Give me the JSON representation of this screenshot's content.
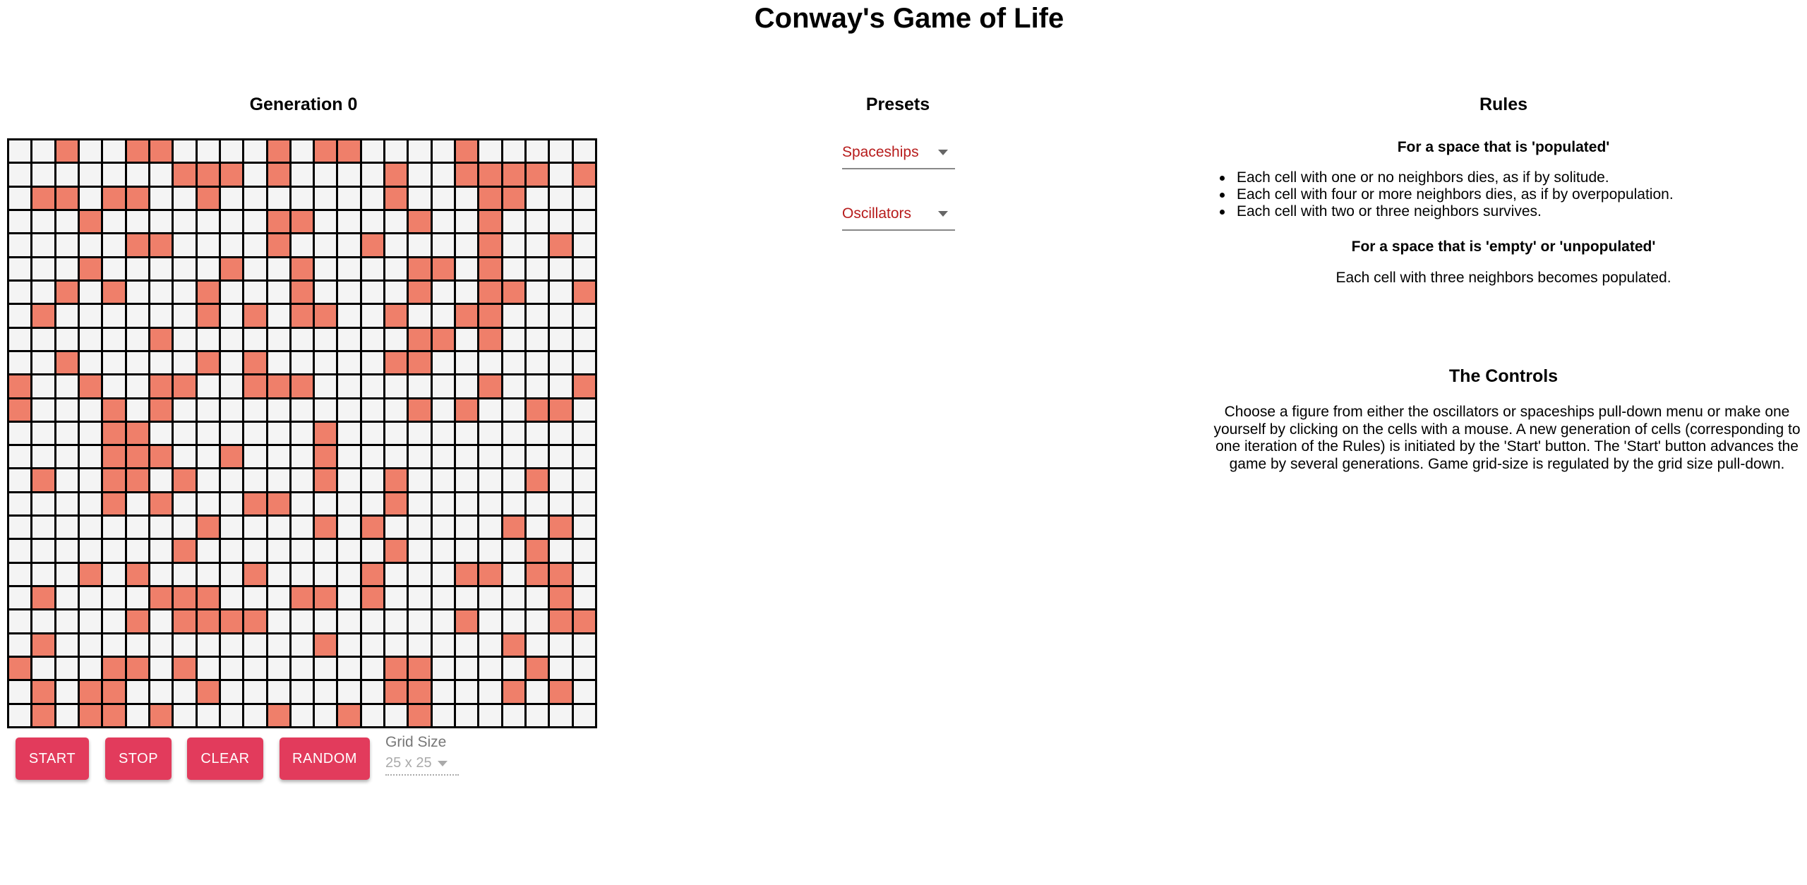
{
  "title": "Conway's Game of Life",
  "generation_heading": "Generation 0",
  "grid": {
    "rows": 25,
    "cols": 25,
    "alive_color": "#ef7f6a",
    "dead_color": "#f4f4f4",
    "alive": [
      "0010011000010110000100000",
      "0000000111010000100111101",
      "0110110010000000100011000",
      "0001000000011000010010000",
      "0000011000010001000010010",
      "0001000001001000011010000",
      "0010100010001000010011001",
      "0100000010101100100110000",
      "0000001000000000011010000",
      "0010000010100000110000000",
      "1001001100111000000010001",
      "1000101000000000010100110",
      "0000110000000100000000000",
      "0000111001000100000000000",
      "0100110100000100100000100",
      "0000101000110000100000000",
      "0000000010000101000001010",
      "0000000100000000100000100",
      "0001010000100001000110110",
      "0100001110001101000000010",
      "0000010111100000000100011",
      "0100000000000100000001000",
      "1000110100000000110000100",
      "0101100010000000110001010",
      "0101101000010010010000000"
    ]
  },
  "controls": {
    "start": "START",
    "stop": "STOP",
    "clear": "CLEAR",
    "random": "RANDOM",
    "grid_size_label": "Grid Size",
    "grid_size_value": "25 x 25"
  },
  "presets": {
    "heading": "Presets",
    "spaceships": "Spaceships",
    "oscillators": "Oscillators"
  },
  "rules": {
    "heading": "Rules",
    "populated_heading": "For a space that is 'populated'",
    "populated_items": [
      "Each cell with one or no neighbors dies, as if by solitude.",
      "Each cell with four or more neighbors dies, as if by overpopulation.",
      "Each cell with two or three neighbors survives."
    ],
    "empty_heading": "For a space that is 'empty' or 'unpopulated'",
    "empty_text": "Each cell with three neighbors becomes populated."
  },
  "the_controls": {
    "heading": "The Controls",
    "text": "Choose a figure from either the oscillators or spaceships pull-down menu or make one yourself by clicking on the cells with a mouse. A new generation of cells (corresponding to one iteration of the Rules) is initiated by the 'Start' button. The 'Start' button advances the game by several generations. Game grid-size is regulated by the grid size pull-down."
  }
}
